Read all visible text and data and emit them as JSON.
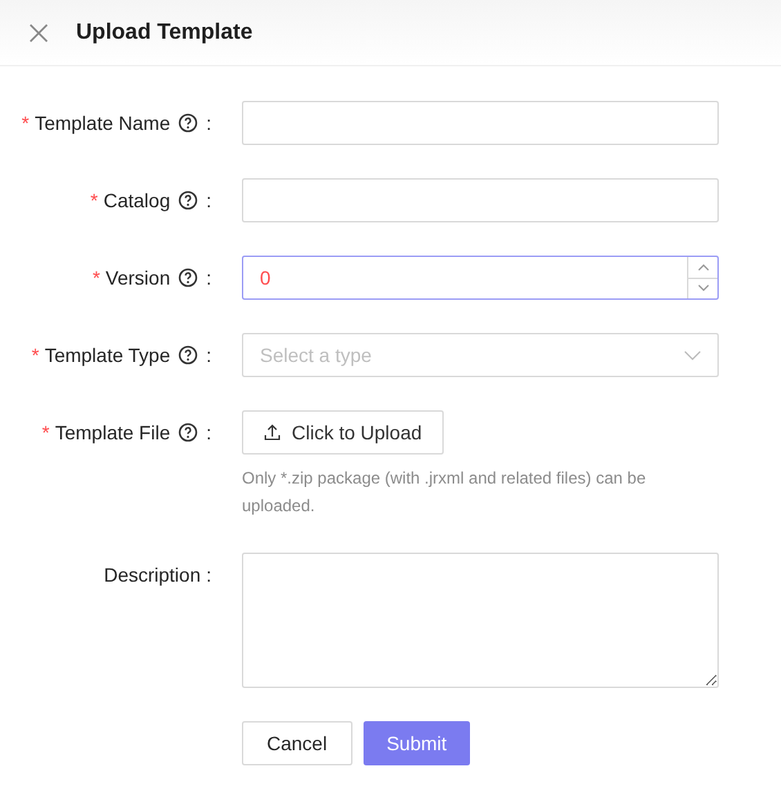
{
  "dialog": {
    "title": "Upload Template"
  },
  "fields": [
    {
      "kind": "text",
      "marker": "*",
      "label": "Template Name",
      "help": true,
      "colon": ":",
      "focused": false
    },
    {
      "kind": "text",
      "marker": "*",
      "label": "Catalog",
      "help": true,
      "colon": ":",
      "focused": false
    },
    {
      "kind": "number",
      "marker": "*",
      "label": "Version",
      "help": true,
      "colon": ":",
      "focused": true,
      "value": "0"
    },
    {
      "kind": "select",
      "marker": "*",
      "label": "Template Type",
      "help": true,
      "colon": ":",
      "focused": false,
      "placeholder": "Select a type"
    },
    {
      "kind": "upload",
      "marker": "*",
      "label": "Template File",
      "help": true,
      "colon": ":",
      "focused": false,
      "button": "Click to Upload",
      "hint": "Only *.zip package (with .jrxml and related files) can be uploaded."
    },
    {
      "kind": "textarea",
      "label": "Description",
      "help": false,
      "colon": ":",
      "focused": false
    }
  ],
  "actions": {
    "cancel": "Cancel",
    "submit": "Submit"
  }
}
